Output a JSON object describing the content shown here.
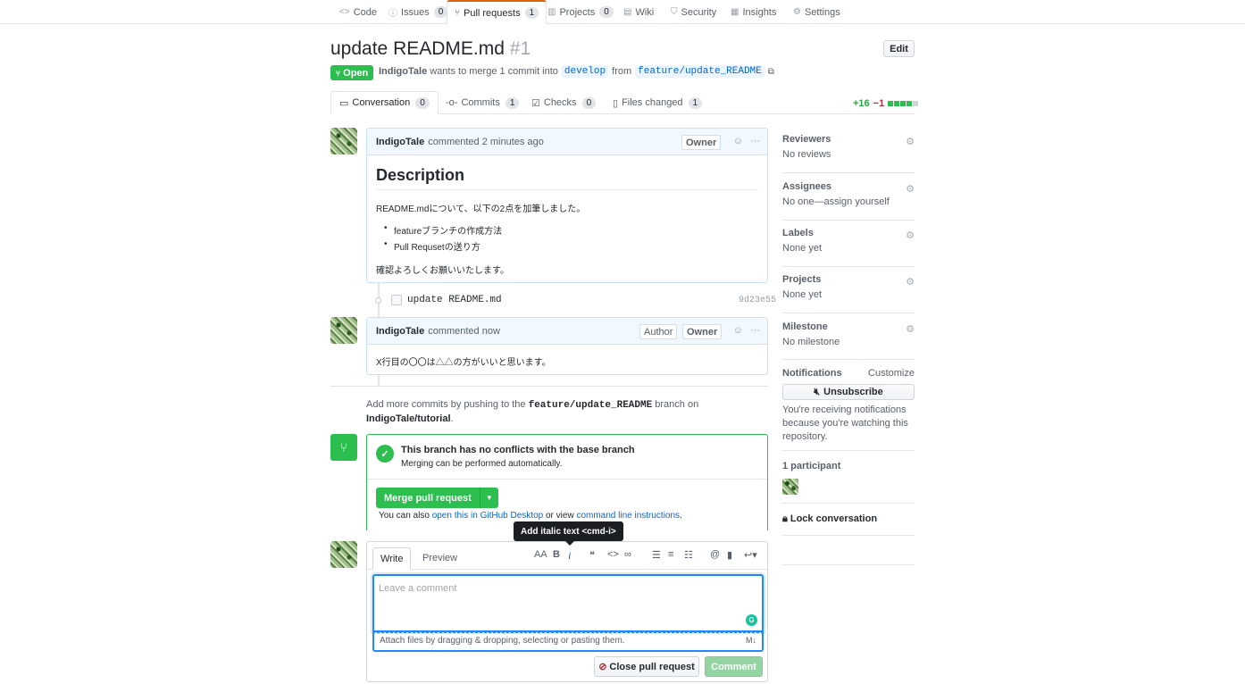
{
  "repo_nav": {
    "tabs": [
      {
        "label": "Code",
        "icon": "code-icon",
        "count": ""
      },
      {
        "label": "Issues",
        "icon": "issue-icon",
        "count": "0"
      },
      {
        "label": "Pull requests",
        "icon": "pull-request-icon",
        "count": "1"
      },
      {
        "label": "Projects",
        "icon": "project-icon",
        "count": "0"
      },
      {
        "label": "Wiki",
        "icon": "book-icon",
        "count": ""
      },
      {
        "label": "Security",
        "icon": "shield-icon",
        "count": ""
      },
      {
        "label": "Insights",
        "icon": "graph-icon",
        "count": ""
      },
      {
        "label": "Settings",
        "icon": "gear-icon",
        "count": ""
      }
    ]
  },
  "pr": {
    "title": "update README.md",
    "number": "#1",
    "edit_label": "Edit",
    "state": "Open",
    "author": "IndigoTale",
    "merge_text_1": "wants to merge 1 commit into",
    "base_branch": "develop",
    "merge_text_2": "from",
    "head_branch": "feature/update_README"
  },
  "pr_tabs": [
    {
      "label": "Conversation",
      "count": "0"
    },
    {
      "label": "Commits",
      "count": "1"
    },
    {
      "label": "Checks",
      "count": "0"
    },
    {
      "label": "Files changed",
      "count": "1"
    }
  ],
  "diffstat": {
    "additions": "+16",
    "deletions": "−1",
    "colors": {
      "add": "#2cbe4e",
      "del": "#cb2431",
      "neutral": "#d1d5da"
    }
  },
  "comment1": {
    "author": "IndigoTale",
    "time": "commented 2 minutes ago",
    "badge": "Owner",
    "heading": "Description",
    "intro": "README.mdについて、以下の2点を加筆しました。",
    "items": [
      "featureブランチの作成方法",
      "Pull Requsetの送り方"
    ],
    "outro": "確認よろしくお願いいたします。"
  },
  "commit": {
    "message": "update README.md",
    "sha": "9d23e55"
  },
  "comment2": {
    "author": "IndigoTale",
    "time": "commented now",
    "badge_author": "Author",
    "badge_owner": "Owner",
    "body": "X行目の〇〇は△△の方がいいと思います。"
  },
  "note": {
    "text_1": "Add more commits by pushing to the",
    "branch": "feature/update_README",
    "text_2": "branch on",
    "repo": "IndigoTale/tutorial",
    "period": "."
  },
  "merge": {
    "title": "This branch has no conflicts with the base branch",
    "subtitle": "Merging can be performed automatically.",
    "button": "Merge pull request",
    "also_text": "You can also",
    "desktop_link": "open this in GitHub Desktop",
    "or_view": "or view",
    "cli_link": "command line instructions",
    "period": "."
  },
  "tooltip": "Add italic text <cmd-i>",
  "editor": {
    "write_tab": "Write",
    "preview_tab": "Preview",
    "toolbar": {
      "heading": "AA",
      "bold": "B",
      "italic": "i"
    },
    "placeholder": "Leave a comment",
    "attach_text": "Attach files by dragging & dropping, selecting or pasting them.",
    "close_button": "Close pull request",
    "comment_button": "Comment"
  },
  "sidebar": {
    "reviewers": {
      "heading": "Reviewers",
      "value": "No reviews"
    },
    "assignees": {
      "heading": "Assignees",
      "value": "No one—assign yourself"
    },
    "labels": {
      "heading": "Labels",
      "value": "None yet"
    },
    "projects": {
      "heading": "Projects",
      "value": "None yet"
    },
    "milestone": {
      "heading": "Milestone",
      "value": "No milestone"
    },
    "notifications": {
      "heading": "Notifications",
      "customize": "Customize",
      "button": "Unsubscribe",
      "reason": "You're receiving notifications because you're watching this repository."
    },
    "participants": {
      "heading": "1 participant"
    },
    "lock": "Lock conversation"
  }
}
